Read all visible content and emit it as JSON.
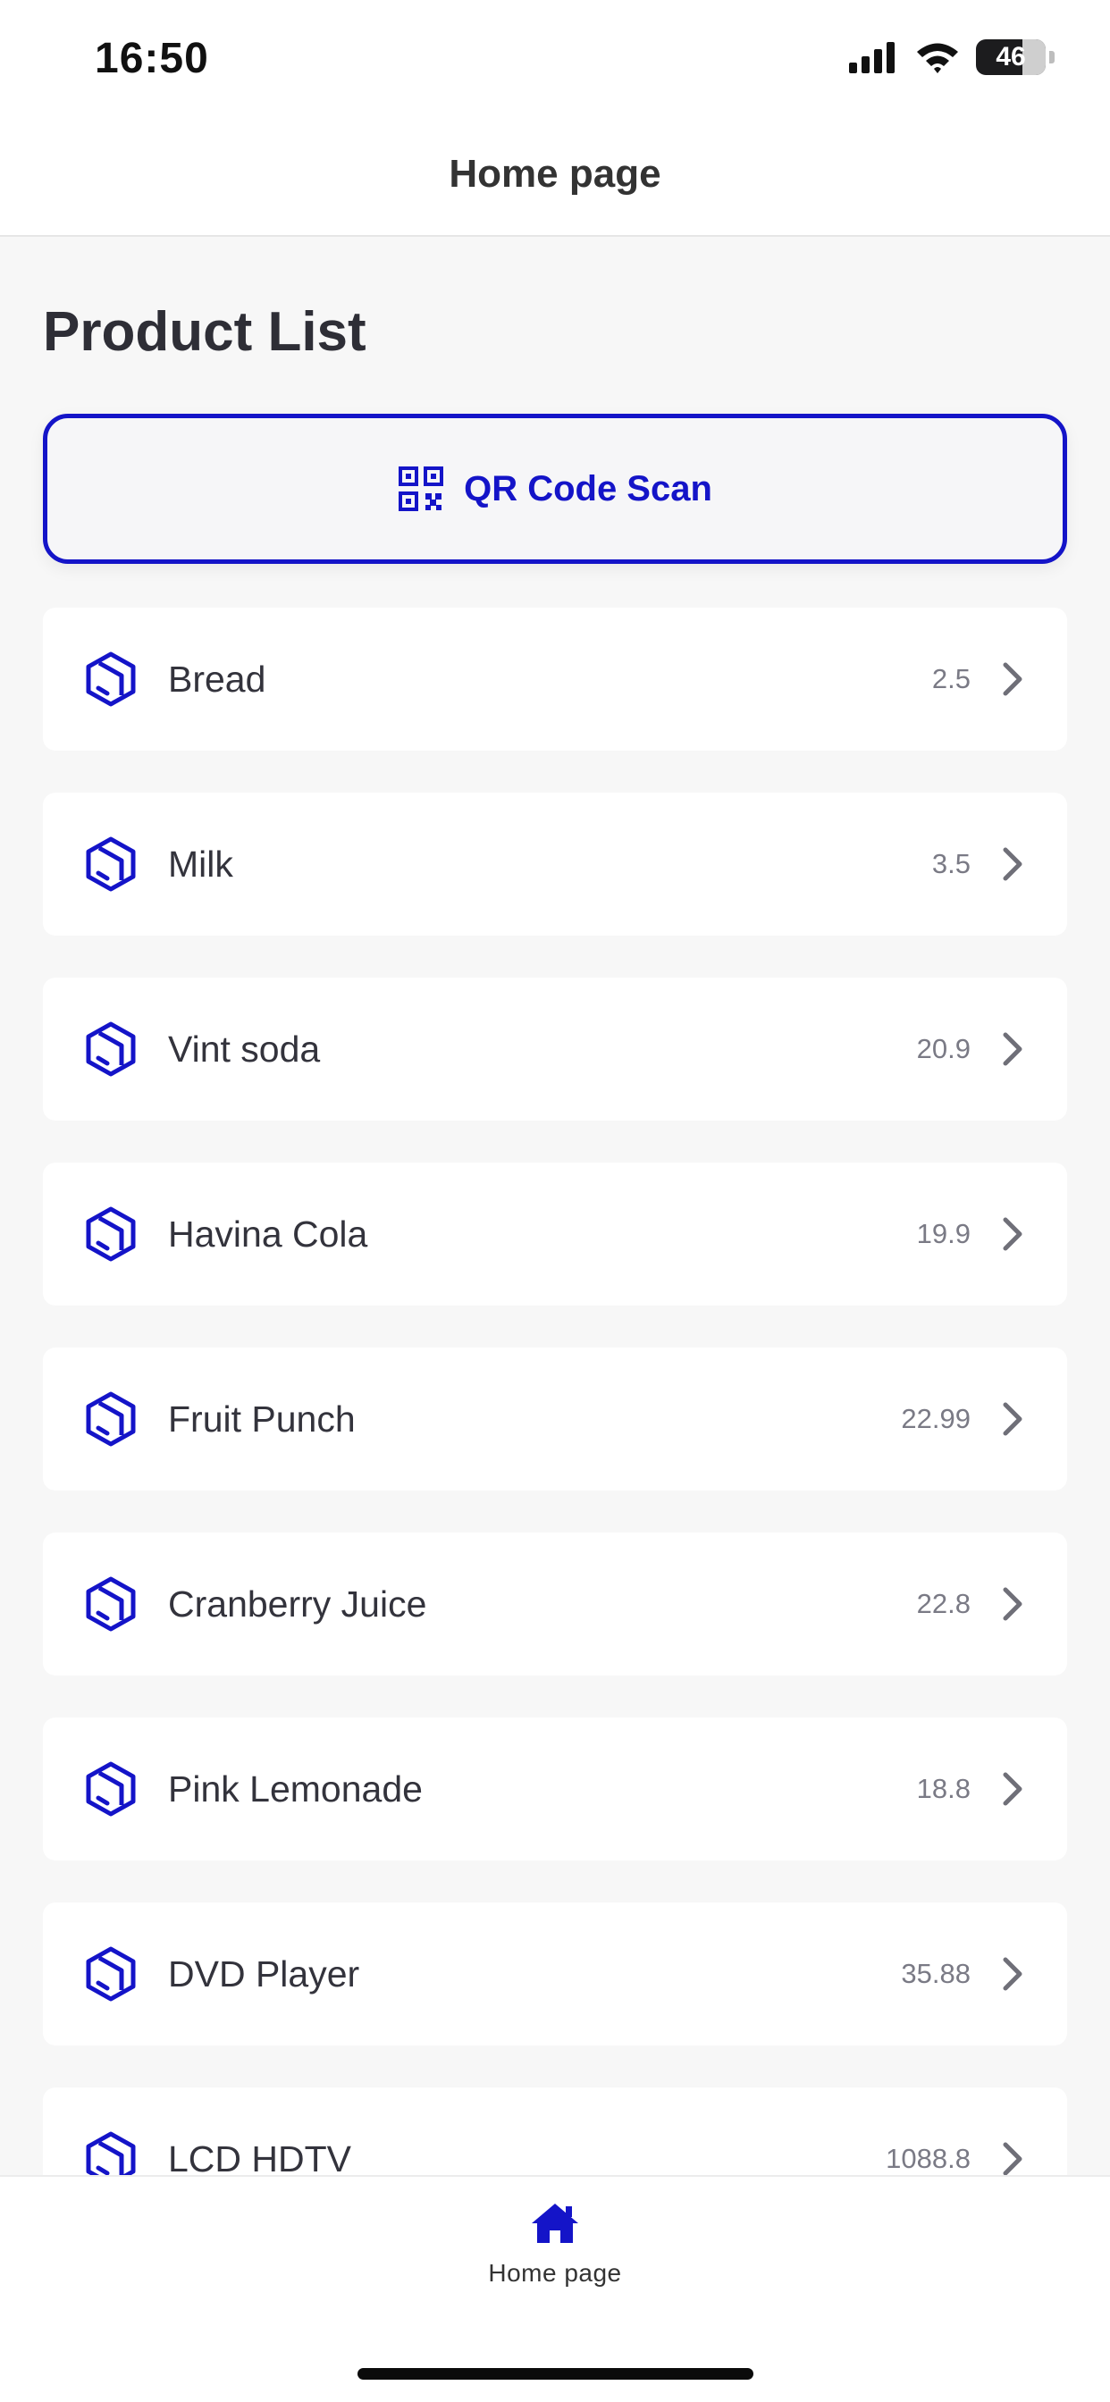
{
  "status_bar": {
    "time": "16:50",
    "battery": "46"
  },
  "header": {
    "title": "Home page"
  },
  "page": {
    "title": "Product List"
  },
  "qr_button": {
    "label": "QR Code Scan",
    "icon": "qr-code-icon"
  },
  "products": [
    {
      "name": "Bread",
      "price": "2.5"
    },
    {
      "name": "Milk",
      "price": "3.5"
    },
    {
      "name": "Vint soda",
      "price": "20.9"
    },
    {
      "name": "Havina Cola",
      "price": "19.9"
    },
    {
      "name": "Fruit Punch",
      "price": "22.99"
    },
    {
      "name": "Cranberry Juice",
      "price": "22.8"
    },
    {
      "name": "Pink Lemonade",
      "price": "18.8"
    },
    {
      "name": "DVD Player",
      "price": "35.88"
    },
    {
      "name": "LCD HDTV",
      "price": "1088.8"
    }
  ],
  "tabbar": {
    "home_label": "Home page"
  },
  "colors": {
    "accent": "#1414c8",
    "background": "#f7f7f7",
    "card": "#ffffff"
  }
}
